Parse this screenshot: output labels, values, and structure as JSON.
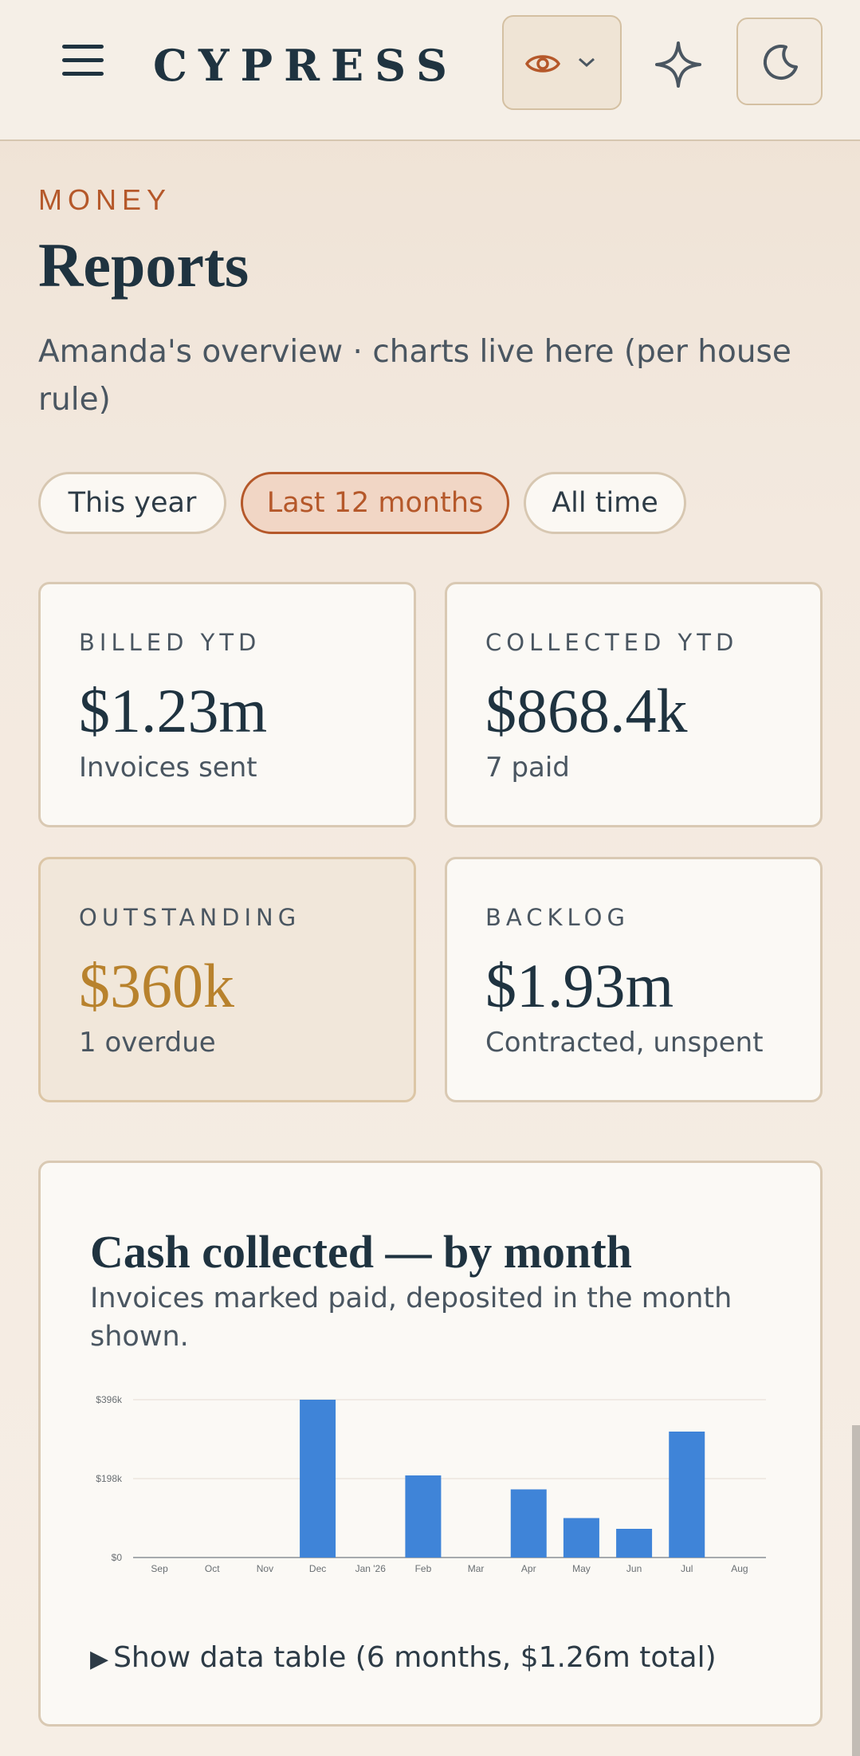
{
  "header": {
    "brand": "CYPRESS",
    "menu_icon": "hamburger-menu-icon",
    "privacy_icon": "eye-icon",
    "ai_icon": "sparkle-icon",
    "theme_icon": "moon-icon"
  },
  "page": {
    "eyebrow": "MONEY",
    "title": "Reports",
    "subtitle": "Amanda's overview · charts live here (per house rule)"
  },
  "filters": {
    "options": [
      "This year",
      "Last 12 months",
      "All time"
    ],
    "selected": "Last 12 months"
  },
  "stats": [
    {
      "label": "BILLED YTD",
      "value": "$1.23m",
      "sub": "Invoices sent"
    },
    {
      "label": "COLLECTED YTD",
      "value": "$868.4k",
      "sub": "7 paid"
    },
    {
      "label": "OUTSTANDING",
      "value": "$360k",
      "sub": "1 overdue"
    },
    {
      "label": "BACKLOG",
      "value": "$1.93m",
      "sub": "Contracted, unspent"
    }
  ],
  "chart": {
    "title": "Cash collected — by month",
    "description": "Invoices marked paid, deposited in the month shown.",
    "toggle_label": "Show data table (6 months, $1.26m total)"
  },
  "colors": {
    "accent": "#b5582a",
    "warning": "#b8822d",
    "bar": "#3f84d8",
    "ink": "#1f3340"
  },
  "chart_data": {
    "type": "bar",
    "categories": [
      "Sep",
      "Oct",
      "Nov",
      "Dec",
      "Jan '26",
      "Feb",
      "Mar",
      "Apr",
      "May",
      "Jun",
      "Jul",
      "Aug"
    ],
    "values": [
      0,
      0,
      0,
      396,
      0,
      206,
      0,
      171,
      99,
      72,
      316,
      0
    ],
    "unit": "$k",
    "ylim": [
      0,
      396
    ],
    "yticks": [
      "$0",
      "$198k",
      "$396k"
    ],
    "ytick_values": [
      0,
      198,
      396
    ],
    "grid": true
  }
}
